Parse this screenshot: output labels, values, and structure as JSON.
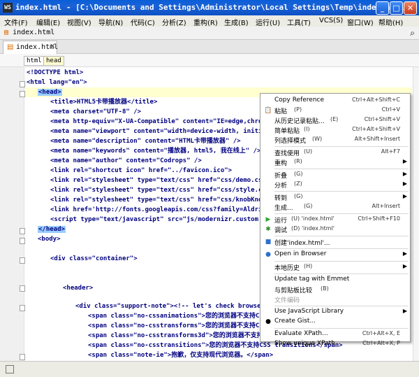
{
  "window": {
    "title": "index.html - [C:\\Documents and Settings\\Administrator\\Local Settings\\Temp\\index.html] - ...",
    "app_icon": "WS"
  },
  "menubar": [
    {
      "label": "文件(F)"
    },
    {
      "label": "编辑(E)"
    },
    {
      "label": "视图(V)"
    },
    {
      "label": "导航(N)"
    },
    {
      "label": "代码(C)"
    },
    {
      "label": "分析(Z)"
    },
    {
      "label": "重构(R)"
    },
    {
      "label": "生成(B)"
    },
    {
      "label": "运行(U)"
    },
    {
      "label": "工具(T)"
    },
    {
      "label": "VCS(S)"
    },
    {
      "label": "窗口(W)"
    },
    {
      "label": "帮助(H)"
    }
  ],
  "navbar": {
    "file": "index.html"
  },
  "tab": {
    "label": "index.html"
  },
  "breadcrumb": [
    "html",
    "head"
  ],
  "code_lines": [
    "<!DOCTYPE html>",
    "<html lang=\"en\">",
    "<head>",
    "<title>HTML5卡带播放器</title>",
    "<meta charset=\"UTF-8\" />",
    "<meta http-equiv=\"X-UA-Compatible\" content=\"IE=edge,chrome=",
    "<meta name=\"viewport\" content=\"width=device-width, initial-",
    "<meta name=\"description\" content=\"HTML卡带播放器\" />",
    "<meta name=\"keywords\" content=\"播放器, html5, 我在线上\" />",
    "<meta name=\"author\" content=\"Codrops\" />",
    "<link rel=\"shortcut icon\" href=\"../favicon.ico\">",
    "<link rel=\"stylesheet\" type=\"text/css\" href=\"css/demo.css\" /",
    "<link rel=\"stylesheet\" type=\"text/css\" href=\"css/style.css\"",
    "<link rel=\"stylesheet\" type=\"text/css\" href=\"css/knobKnob.cs",
    "<link href='http://fonts.googleapis.com/css?family=Aldrich'",
    "<script type=\"text/javascript\" src=\"js/modernizr.custom.691",
    "</head>",
    "<body>",
    "",
    "<div class=\"container\">",
    "",
    "",
    "<header>",
    "",
    "<div class=\"support-note\"><!-- let's check browser suppor",
    "<span class=\"no-cssanimations\">您的浏览器不支持CSS动",
    "<span class=\"no-csstransforms\">您的浏览器不支持CSS t",
    "<span class=\"no-csstransforms3d\">您的浏览器不支持CSS",
    "<span class=\"no-csstransitions\">您的浏览器不支持CSS transitions</span>",
    "<span class=\"note-ie\">抱歉，仅支持现代浏览器。</span>"
  ],
  "context_menu": [
    {
      "label": "Copy Reference",
      "shortcut": "Ctrl+Alt+Shift+C",
      "icon": "",
      "arrow": false
    },
    {
      "label": "粘贴",
      "mnemonic": "(P)",
      "shortcut": "Ctrl+V",
      "icon": "paste-icon",
      "arrow": false
    },
    {
      "label": "从历史记录粘贴...",
      "mnemonic": "(E)",
      "shortcut": "Ctrl+Shift+V",
      "icon": "",
      "arrow": false
    },
    {
      "label": "简单粘贴",
      "mnemonic": "(I)",
      "shortcut": "Ctrl+Alt+Shift+V",
      "icon": "",
      "arrow": false
    },
    {
      "label": "列选择模式",
      "mnemonic": "(W)",
      "shortcut": "Alt+Shift+Insert",
      "icon": "",
      "arrow": false
    },
    {
      "sep": true
    },
    {
      "label": "查找使用",
      "mnemonic": "(U)",
      "shortcut": "Alt+F7",
      "icon": "",
      "arrow": false
    },
    {
      "label": "重构",
      "mnemonic": "(R)",
      "shortcut": "",
      "icon": "",
      "arrow": true
    },
    {
      "sep": true
    },
    {
      "label": "折叠",
      "mnemonic": "(G)",
      "shortcut": "",
      "icon": "",
      "arrow": true
    },
    {
      "label": "分析",
      "mnemonic": "(Z)",
      "shortcut": "",
      "icon": "",
      "arrow": true
    },
    {
      "sep": true
    },
    {
      "label": "转到",
      "mnemonic": "(G)",
      "shortcut": "",
      "icon": "",
      "arrow": true
    },
    {
      "label": "生成...",
      "mnemonic": "(G)",
      "shortcut": "Alt+Insert",
      "icon": "",
      "arrow": false
    },
    {
      "sep": true
    },
    {
      "label": "运行",
      "mnemonic": "(U) 'index.html'",
      "shortcut": "Ctrl+Shift+F10",
      "icon": "run-icon",
      "arrow": false
    },
    {
      "label": "调试",
      "mnemonic": "(D) 'index.html'",
      "shortcut": "",
      "icon": "debug-icon",
      "arrow": false
    },
    {
      "sep": true
    },
    {
      "label": "创建'index.html'...",
      "mnemonic": "",
      "shortcut": "",
      "icon": "create-icon",
      "arrow": false
    },
    {
      "sep": true
    },
    {
      "label": "Open in Browser",
      "mnemonic": "",
      "shortcut": "",
      "icon": "browser-icon",
      "arrow": true
    },
    {
      "sep": true
    },
    {
      "label": "本地历史",
      "mnemonic": "(H)",
      "shortcut": "",
      "icon": "",
      "arrow": true
    },
    {
      "sep": true
    },
    {
      "label": "Update tag with Emmet",
      "mnemonic": "",
      "shortcut": "",
      "icon": "",
      "arrow": false
    },
    {
      "label": "与剪贴板比较",
      "mnemonic": "(B)",
      "shortcut": "",
      "icon": "",
      "arrow": false
    },
    {
      "label": "文件编码",
      "mnemonic": "",
      "shortcut": "",
      "icon": "",
      "arrow": false,
      "disabled": true
    },
    {
      "sep": true
    },
    {
      "label": "Use JavaScript Library",
      "mnemonic": "",
      "shortcut": "",
      "icon": "",
      "arrow": true
    },
    {
      "label": "Create Gist...",
      "mnemonic": "",
      "shortcut": "",
      "icon": "github-icon",
      "arrow": false
    },
    {
      "sep": true
    },
    {
      "label": "Evaluate XPath...",
      "mnemonic": "",
      "shortcut": "Ctrl+Alt+X, E",
      "icon": "",
      "arrow": false
    },
    {
      "label": "Show unique XPath",
      "mnemonic": "",
      "shortcut": "Ctrl+Alt+X, P",
      "icon": "",
      "arrow": false
    }
  ]
}
